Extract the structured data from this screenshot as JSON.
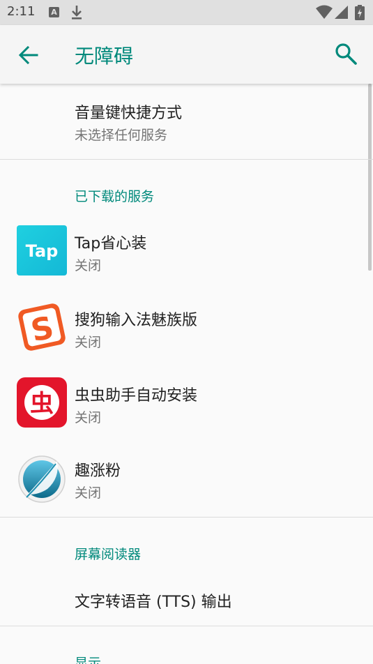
{
  "status_bar": {
    "time": "2:11",
    "a_icon_label": "A"
  },
  "app_bar": {
    "title": "无障碍",
    "accent_color": "#00897b"
  },
  "shortcut": {
    "title": "音量键快捷方式",
    "subtitle": "未选择任何服务"
  },
  "downloaded": {
    "header": "已下载的服务",
    "items": [
      {
        "title": "Tap省心装",
        "subtitle": "关闭",
        "icon": "taptap-app-icon",
        "icon_text": "Tap"
      },
      {
        "title": "搜狗输入法魅族版",
        "subtitle": "关闭",
        "icon": "sogou-app-icon",
        "icon_text": "S"
      },
      {
        "title": "虫虫助手自动安装",
        "subtitle": "关闭",
        "icon": "chongchong-app-icon",
        "icon_text": "虫"
      },
      {
        "title": "趣涨粉",
        "subtitle": "关闭",
        "icon": "feather-app-icon"
      }
    ]
  },
  "screen_reader": {
    "header": "屏幕阅读器",
    "items": [
      {
        "title": "文字转语音 (TTS) 输出"
      }
    ]
  },
  "display": {
    "header": "显示"
  }
}
